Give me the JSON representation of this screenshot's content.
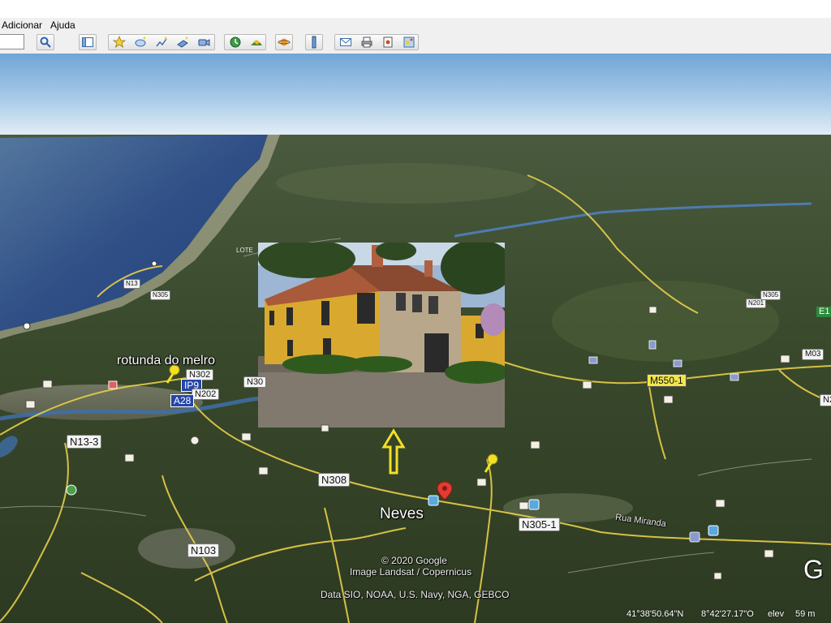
{
  "menu": {
    "items": [
      "Adicionar",
      "Ajuda"
    ]
  },
  "toolbar": {
    "icons": [
      "search-icon",
      "sidebar-toggle-icon",
      "placemark-icon",
      "polygon-icon",
      "path-icon",
      "image-overlay-icon",
      "record-tour-icon",
      "historical-imagery-icon",
      "sunlight-icon",
      "planets-icon",
      "ruler-icon",
      "email-icon",
      "print-icon",
      "save-image-icon",
      "view-in-maps-icon"
    ]
  },
  "map": {
    "places": [
      {
        "name": "rotunda do melro"
      },
      {
        "name": "Neves"
      }
    ],
    "roads": {
      "n302": "N302",
      "ip9": "IP9",
      "n202": "N202",
      "a28": "A28",
      "n13_3": "N13-3",
      "n308": "N308",
      "n103": "N103",
      "n305_1": "N305-1",
      "m550_1": "M550-1",
      "n13": "N13",
      "n305": "N305",
      "n201": "N201",
      "lote": "LOTE",
      "n30": "N30",
      "e1": "E1",
      "m03": "M03",
      "n2": "N2",
      "n305b": "N305",
      "rua_miranda": "Rua Miranda"
    },
    "attribution": [
      "© 2020 Google",
      "Image Landsat / Copernicus",
      "Data SIO, NOAA, U.S. Navy, NGA, GEBCO"
    ],
    "logo_letter": "G"
  },
  "status": {
    "latitude": "41°38'50.64\"N",
    "longitude": "8°42'27.17\"O",
    "elev_label": "elev",
    "elevation": "59 m"
  },
  "colors": {
    "road": "#e8cf4a",
    "river": "#3f6ea8",
    "sea": "#2d4f86"
  }
}
